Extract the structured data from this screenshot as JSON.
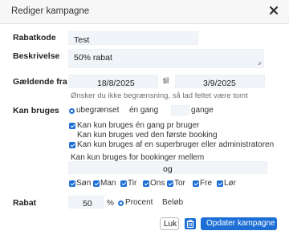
{
  "dialog": {
    "title": "Rediger kampagne",
    "close_icon": "close-icon"
  },
  "form": {
    "code": {
      "label": "Rabatkode",
      "value": "Test"
    },
    "description": {
      "label": "Beskrivelse",
      "value": "50% rabat"
    },
    "validity": {
      "label": "Gældende fra",
      "from": "18/8/2025",
      "to_word": "til",
      "to": "3/9/2025",
      "hint": "Ønsker du ikke begrænsning, så lad feltet være tomt"
    },
    "usage": {
      "label": "Kan bruges",
      "radio_unlimited": "ubegrænset",
      "radio_once": "én gang",
      "radio_times": "gange",
      "checkboxes": [
        {
          "label": "Kan kun bruges én gang pr bruger",
          "checked": true
        },
        {
          "label": "Kan kun bruges ved den første booking",
          "checked": false
        },
        {
          "label": "Kan kun bruges af en superbruger eller administratoren",
          "checked": true
        }
      ],
      "between_label": "Kan kun bruges for bookinger mellem",
      "between_and": "og",
      "days": [
        {
          "label": "Søn",
          "checked": true
        },
        {
          "label": "Man",
          "checked": true
        },
        {
          "label": "Tir",
          "checked": true
        },
        {
          "label": "Ons",
          "checked": true
        },
        {
          "label": "Tor",
          "checked": true
        },
        {
          "label": "Fre",
          "checked": true
        },
        {
          "label": "Lør",
          "checked": true
        }
      ]
    },
    "discount": {
      "label": "Rabat",
      "value": "50",
      "unit": "%",
      "radio_percent": "Procent",
      "radio_amount": "Beløb",
      "selected": "Procent"
    }
  },
  "buttons": {
    "close": "Luk",
    "delete_icon": "trash-icon",
    "update": "Opdater kampagne"
  },
  "colors": {
    "accent": "#1d6fd6",
    "field_bg": "#f1f4f8"
  }
}
